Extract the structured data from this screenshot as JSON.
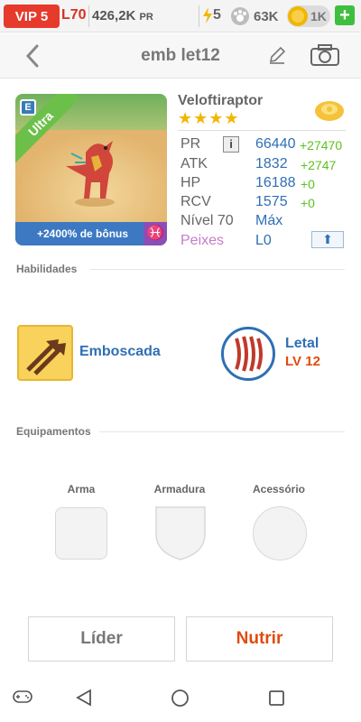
{
  "status": {
    "vip": "VIP 5",
    "level": "L70",
    "power": "426,2K",
    "power_unit": "PR",
    "energy": "5",
    "food": "63K",
    "gold": "1K",
    "plus": "+"
  },
  "header": {
    "title": "emb let12"
  },
  "card": {
    "rarity": "Ultra",
    "bonus": "+2400% de bônus",
    "zodiac_symbol": "♓",
    "element_symbol": "E"
  },
  "dino": {
    "name": "Veloftiraptor",
    "stars": "★★★★",
    "stats": [
      {
        "label": "PR",
        "value": "66440",
        "inc": "+27470"
      },
      {
        "label": "ATK",
        "value": "1832",
        "inc": "+2747"
      },
      {
        "label": "HP",
        "value": "16188",
        "inc": "+0"
      },
      {
        "label": "RCV",
        "value": "1575",
        "inc": "+0"
      }
    ],
    "level_label": "Nível 70",
    "level_value": "Máx",
    "fish_label": "Peixes",
    "fish_value": "L0",
    "info_symbol": "i",
    "upgrade_symbol": "⬆"
  },
  "skills": {
    "section_title": "Habilidades",
    "items": [
      {
        "name": "Emboscada"
      },
      {
        "name": "Letal",
        "level": "LV 12"
      }
    ]
  },
  "equipment": {
    "section_title": "Equipamentos",
    "slots": [
      "Arma",
      "Armadura",
      "Acessório"
    ]
  },
  "actions": {
    "leader": "Líder",
    "feed": "Nutrir"
  },
  "colors": {
    "accent_blue": "#2f6fb5",
    "accent_red": "#e04b0f",
    "green": "#5cc21e"
  }
}
